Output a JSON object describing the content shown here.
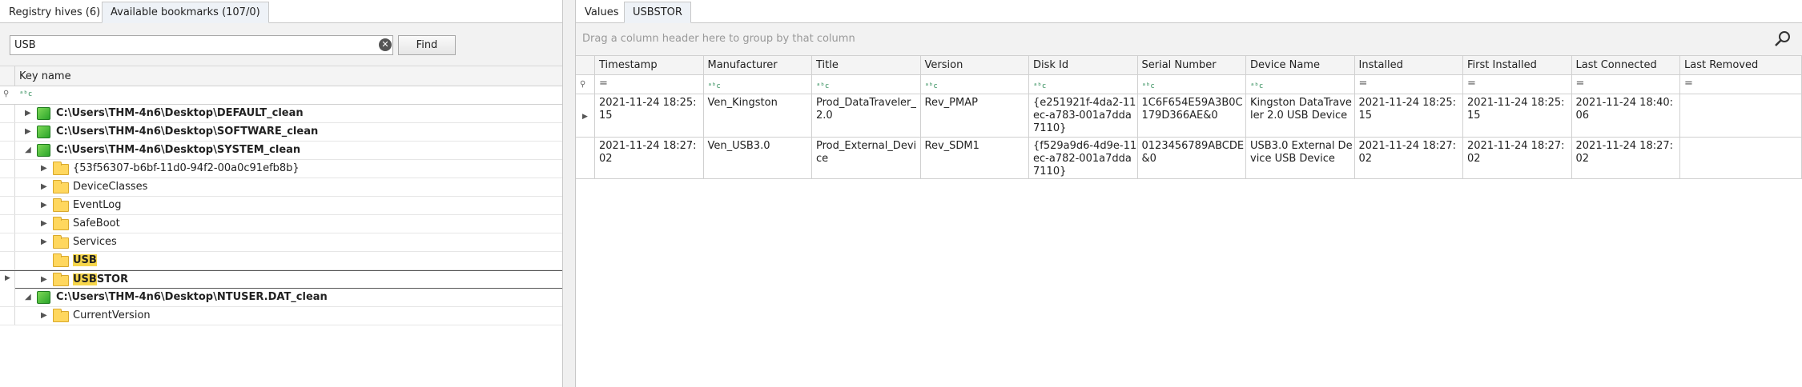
{
  "left_panel": {
    "tabs": [
      {
        "label": "Registry hives (6)"
      },
      {
        "label": "Available bookmarks (107/0)"
      }
    ],
    "search": {
      "value": "USB",
      "find_label": "Find"
    },
    "column_header": "Key name",
    "filter_icon": "abc-filter-icon",
    "tree": [
      {
        "type": "hive",
        "text": "C:\\Users\\THM-4n6\\Desktop\\DEFAULT_clean"
      },
      {
        "type": "hive",
        "text": "C:\\Users\\THM-4n6\\Desktop\\SOFTWARE_clean"
      },
      {
        "type": "hive",
        "text": "C:\\Users\\THM-4n6\\Desktop\\SYSTEM_clean"
      },
      {
        "type": "folder",
        "text": "{53f56307-b6bf-11d0-94f2-00a0c91efb8b}"
      },
      {
        "type": "folder",
        "text": "DeviceClasses"
      },
      {
        "type": "folder",
        "text": "EventLog"
      },
      {
        "type": "folder",
        "text": "SafeBoot"
      },
      {
        "type": "folder",
        "text": "Services"
      },
      {
        "type": "folder",
        "text": "USB",
        "highlight": "USB"
      },
      {
        "type": "folder",
        "text": "USBSTOR",
        "highlight": "USB",
        "rest": "STOR"
      },
      {
        "type": "hive",
        "text": "C:\\Users\\THM-4n6\\Desktop\\NTUSER.DAT_clean"
      },
      {
        "type": "folder",
        "text": "CurrentVersion"
      }
    ]
  },
  "right_panel": {
    "tabs": [
      {
        "label": "Values"
      },
      {
        "label": "USBSTOR"
      }
    ],
    "group_hint": "Drag a column header here to group by that column",
    "columns": [
      "Timestamp",
      "Manufacturer",
      "Title",
      "Version",
      "Disk Id",
      "Serial Number",
      "Device Name",
      "Installed",
      "First Installed",
      "Last Connected",
      "Last Removed"
    ],
    "rows": [
      [
        "2021-11-24 18:25:15",
        "Ven_Kingston",
        "Prod_DataTraveler_2.0",
        "Rev_PMAP",
        "{e251921f-4da2-11ec-a783-001a7dda7110}",
        "1C6F654E59A3B0C179D366AE&0",
        "Kingston DataTraveler 2.0 USB Device",
        "2021-11-24 18:25:15",
        "2021-11-24 18:25:15",
        "2021-11-24 18:40:06",
        ""
      ],
      [
        "2021-11-24 18:27:02",
        "Ven_USB3.0",
        "Prod_External_Device",
        "Rev_SDM1",
        "{f529a9d6-4d9e-11ec-a782-001a7dda7110}",
        "0123456789ABCDE&0",
        "USB3.0 External Device USB Device",
        "2021-11-24 18:27:02",
        "2021-11-24 18:27:02",
        "2021-11-24 18:27:02",
        ""
      ]
    ]
  }
}
